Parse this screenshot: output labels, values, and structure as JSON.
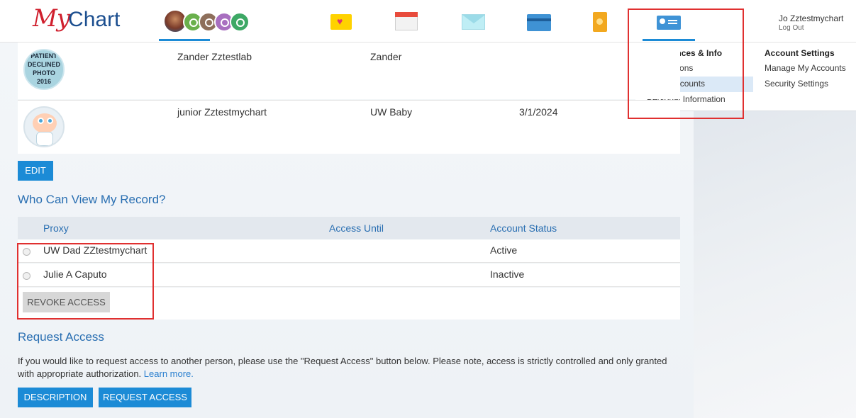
{
  "header": {
    "logo_my": "My",
    "logo_chart": "Chart",
    "user_name": "Jo Zztestmychart",
    "logout_label": "Log Out"
  },
  "menu": {
    "col1_heading": "Preferences & Info",
    "col1_items": [
      "Notifications",
      "Other Accounts",
      "Personal Information"
    ],
    "col2_heading": "Account Settings",
    "col2_items": [
      "Manage My Accounts",
      "Security Settings"
    ],
    "highlighted_item": "Other Accounts"
  },
  "people": [
    {
      "photo_text": [
        "PATIENT",
        "DECLINED",
        "PHOTO",
        "2016"
      ],
      "name": "Zander Zztestlab",
      "nickname": "Zander",
      "date": ""
    },
    {
      "name": "junior Zztestmychart",
      "nickname": "UW Baby",
      "date": "3/1/2024"
    }
  ],
  "edit_label": "EDIT",
  "who_can_view": {
    "title": "Who Can View My Record?",
    "columns": [
      "Proxy",
      "Access Until",
      "Account Status"
    ],
    "rows": [
      {
        "proxy": "UW Dad ZZtestmychart",
        "access_until": "",
        "status": "Active"
      },
      {
        "proxy": "Julie A Caputo",
        "access_until": "",
        "status": "Inactive"
      }
    ],
    "revoke_label": "REVOKE ACCESS"
  },
  "request_access": {
    "title": "Request Access",
    "text": "If you would like to request access to another person, please use the \"Request Access\" button below. Please note, access is strictly controlled and only granted with appropriate authorization.",
    "learn_more": "Learn more.",
    "description_label": "DESCRIPTION",
    "request_label": "REQUEST ACCESS"
  },
  "colors": {
    "accent": "#1c8bd6",
    "heading_blue": "#2a6fb2",
    "annotation_red": "#e03030"
  }
}
